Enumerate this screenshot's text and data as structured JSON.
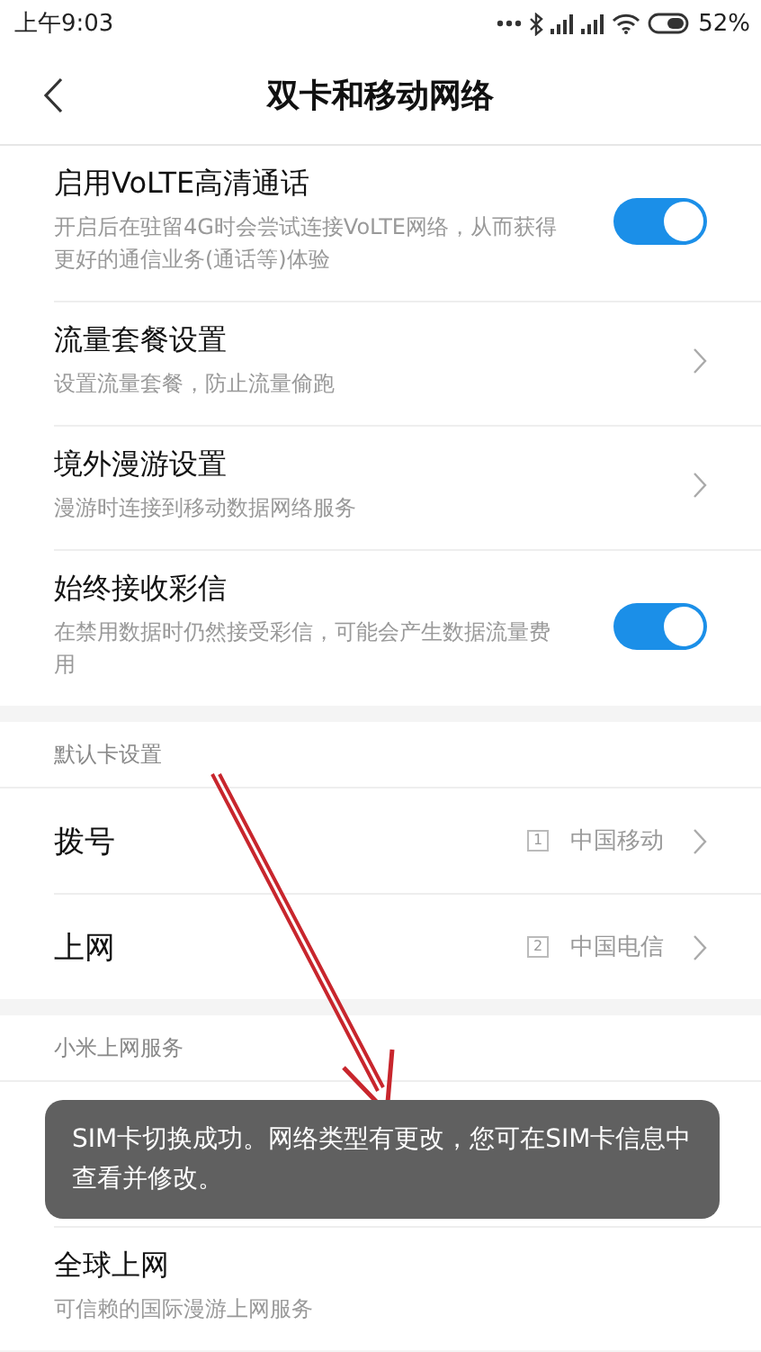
{
  "status_bar": {
    "time": "上午9:03",
    "battery": "52%"
  },
  "header": {
    "title": "双卡和移动网络"
  },
  "sections": [
    {
      "items": [
        {
          "kind": "switch",
          "title": "启用VoLTE高清通话",
          "subtitle": "开启后在驻留4G时会尝试连接VoLTE网络，从而获得更好的通信业务(通话等)体验",
          "on": true
        },
        {
          "kind": "nav",
          "title": "流量套餐设置",
          "subtitle": "设置流量套餐，防止流量偷跑"
        },
        {
          "kind": "nav",
          "title": "境外漫游设置",
          "subtitle": "漫游时连接到移动数据网络服务"
        },
        {
          "kind": "switch",
          "title": "始终接收彩信",
          "subtitle": "在禁用数据时仍然接受彩信，可能会产生数据流量费用",
          "on": true
        }
      ]
    },
    {
      "header": "默认卡设置",
      "items": [
        {
          "kind": "value",
          "title": "拨号",
          "slot": "1",
          "value": "中国移动"
        },
        {
          "kind": "value",
          "title": "上网",
          "slot": "2",
          "value": "中国电信"
        }
      ]
    },
    {
      "header": "小米上网服务",
      "items": [
        {
          "kind": "covered"
        },
        {
          "kind": "nav-plain",
          "title": "全球上网",
          "subtitle": "可信赖的国际漫游上网服务"
        }
      ]
    }
  ],
  "toast": {
    "text": "SIM卡切换成功。网络类型有更改，您可在SIM卡信息中查看并修改。"
  }
}
